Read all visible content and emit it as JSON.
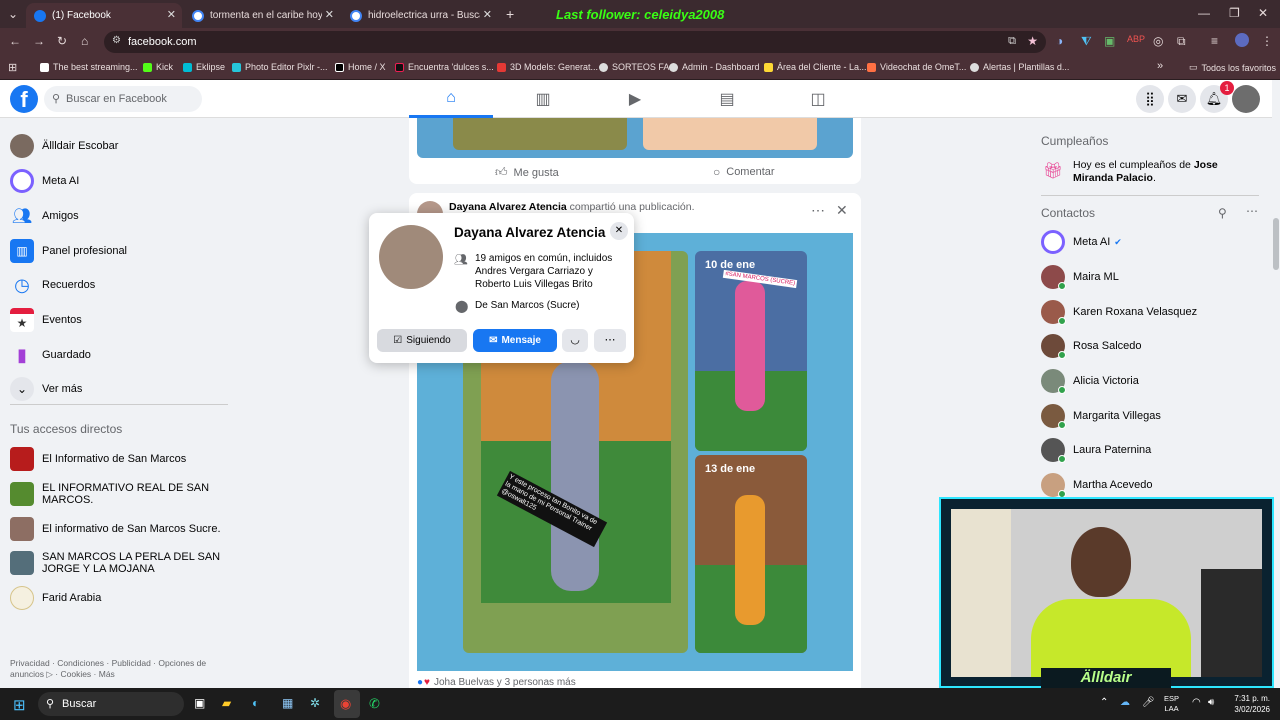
{
  "browser": {
    "tabs": [
      {
        "title": "(1) Facebook",
        "active": true,
        "color": "#1877f2"
      },
      {
        "title": "tormenta en el caribe hoy - Bus",
        "active": false,
        "color": "#ffffff"
      },
      {
        "title": "hidroelectrica urra - Buscar con",
        "active": false,
        "color": "#ffffff"
      }
    ],
    "stream_overlay": "Last follower: celeidya2008",
    "url": "facebook.com",
    "bookmarks": [
      "The best streaming...",
      "Kick",
      "Eklipse",
      "Photo Editor Pixlr -...",
      "Home / X",
      "Encuentra 'dulces s...",
      "3D Models: Generat...",
      "SORTEOS FA",
      "Admin - Dashboard",
      "Área del Cliente - La...",
      "Videochat de OmeT...",
      "Alertas | Plantillas d..."
    ],
    "favorites_label": "Todos los favoritos"
  },
  "fb": {
    "search_placeholder": "Buscar en Facebook",
    "notif_count": "1",
    "left_nav": [
      {
        "label": "Ällldair Escobar"
      },
      {
        "label": "Meta AI"
      },
      {
        "label": "Amigos"
      },
      {
        "label": "Panel profesional"
      },
      {
        "label": "Recuerdos"
      },
      {
        "label": "Eventos"
      },
      {
        "label": "Guardado"
      },
      {
        "label": "Ver más"
      }
    ],
    "shortcuts_title": "Tus accesos directos",
    "shortcuts": [
      {
        "label": "El Informativo de San Marcos"
      },
      {
        "label": "EL INFORMATIVO REAL DE SAN MARCOS."
      },
      {
        "label": "El informativo de San Marcos Sucre."
      },
      {
        "label": "SAN MARCOS LA PERLA DEL SAN JORGE Y LA MOJANA"
      },
      {
        "label": "Farid Arabia"
      }
    ],
    "footer": "Privacidad · Condiciones · Publicidad · Opciones de anuncios ▷ · Cookies · Más",
    "post1": {
      "like": "Me gusta",
      "comment": "Comentar"
    },
    "post2": {
      "author": "Dayana Alvarez Atencia",
      "action": "compartió una publicación.",
      "date1": "10 de ene",
      "date2": "13 de ene",
      "sticker": "#SAN MARCOS (SUCRE)",
      "caption": "Y este proceso tan Bonito va de la mano de mi Personal Trainer @oswalt125",
      "reactions": "Joha Buelvas y 3 personas más"
    },
    "hovercard": {
      "name": "Dayana Alvarez Atencia",
      "mutual_prefix": "19 amigos en común, incluidos ",
      "mutual_names": "Andres Vergara Carriazo",
      "mutual_and": " y ",
      "mutual_names2": "Roberto Luis Villegas Brito",
      "location_prefix": "De ",
      "location": "San Marcos (Sucre)",
      "following": "Siguiendo",
      "message": "Mensaje"
    },
    "birthdays": {
      "title": "Cumpleaños",
      "text_prefix": "Hoy es el cumpleaños de ",
      "name": "Jose Miranda Palacio",
      "text_suffix": "."
    },
    "contacts_title": "Contactos",
    "contacts": [
      {
        "name": "Meta AI",
        "verified": true
      },
      {
        "name": "Maira ML"
      },
      {
        "name": "Karen Roxana Velasquez"
      },
      {
        "name": "Rosa Salcedo"
      },
      {
        "name": "Alicia Victoria"
      },
      {
        "name": "Margarita Villegas"
      },
      {
        "name": "Laura Paternina"
      },
      {
        "name": "Martha Acevedo"
      }
    ]
  },
  "webcam": {
    "label": "Ällldair"
  },
  "taskbar": {
    "search": "Buscar",
    "lang1": "ESP",
    "lang2": "LAA",
    "time": "7:31 p. m.",
    "date": "3/02/2026"
  }
}
